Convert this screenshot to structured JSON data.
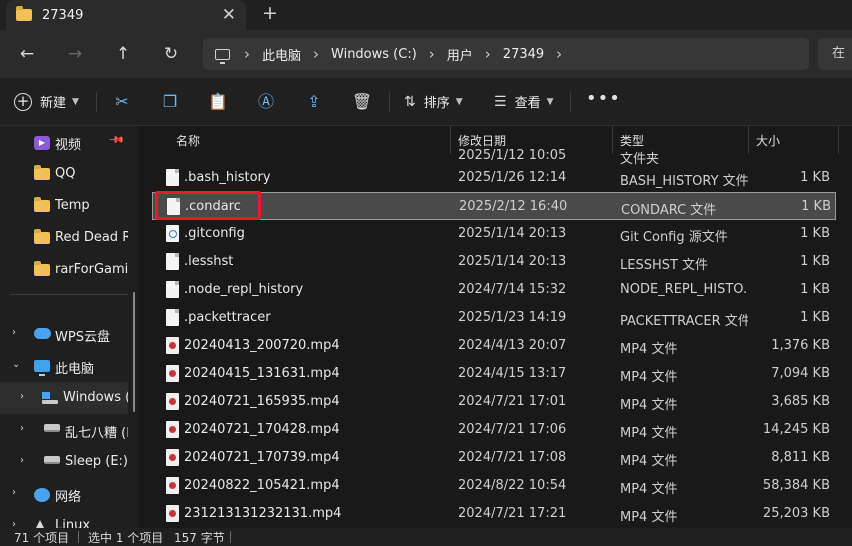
{
  "tab": {
    "title": "27349"
  },
  "address": {
    "crumbs": [
      "此电脑",
      "Windows (C:)",
      "用户",
      "27349"
    ],
    "search_hint": "在"
  },
  "toolbar": {
    "new_label": "新建",
    "sort_label": "排序",
    "view_label": "查看"
  },
  "sidebar": {
    "items": [
      {
        "label": "视频",
        "icon": "video-icon"
      },
      {
        "label": "QQ",
        "icon": "folder-icon"
      },
      {
        "label": "Temp",
        "icon": "folder-icon"
      },
      {
        "label": "Red Dead R",
        "icon": "folder-icon"
      },
      {
        "label": "rarForGamin",
        "icon": "folder-icon"
      },
      {
        "label": "WPS云盘",
        "icon": "cloud-icon"
      },
      {
        "label": "此电脑",
        "icon": "computer-icon"
      },
      {
        "label": "Windows (",
        "icon": "windows-drive-icon"
      },
      {
        "label": "乱七八糟 (D",
        "icon": "drive-icon"
      },
      {
        "label": "Sleep (E:)",
        "icon": "drive-icon"
      },
      {
        "label": "网络",
        "icon": "network-icon"
      },
      {
        "label": "Linux",
        "icon": "linux-icon"
      }
    ]
  },
  "columns": {
    "name": "名称",
    "date": "修改日期",
    "type": "类型",
    "size": "大小"
  },
  "partial_row": {
    "name": "",
    "date": "2025/1/12 10:05",
    "type": "文件夹"
  },
  "files": [
    {
      "name": ".bash_history",
      "date": "2025/1/26 12:14",
      "type": "BASH_HISTORY 文件",
      "size": "1 KB",
      "icon": "doc"
    },
    {
      "name": ".condarc",
      "date": "2025/2/12 16:40",
      "type": "CONDARC 文件",
      "size": "1 KB",
      "icon": "doc"
    },
    {
      "name": ".gitconfig",
      "date": "2025/1/14 20:13",
      "type": "Git Config 源文件",
      "size": "1 KB",
      "icon": "git"
    },
    {
      "name": ".lesshst",
      "date": "2025/1/14 20:13",
      "type": "LESSHST 文件",
      "size": "1 KB",
      "icon": "doc"
    },
    {
      "name": ".node_repl_history",
      "date": "2024/7/14 15:32",
      "type": "NODE_REPL_HISTO...",
      "size": "1 KB",
      "icon": "doc"
    },
    {
      "name": ".packettracer",
      "date": "2025/1/23 14:19",
      "type": "PACKETTRACER 文件",
      "size": "1 KB",
      "icon": "doc"
    },
    {
      "name": "20240413_200720.mp4",
      "date": "2024/4/13 20:07",
      "type": "MP4 文件",
      "size": "1,376 KB",
      "icon": "mp4"
    },
    {
      "name": "20240415_131631.mp4",
      "date": "2024/4/15 13:17",
      "type": "MP4 文件",
      "size": "7,094 KB",
      "icon": "mp4"
    },
    {
      "name": "20240721_165935.mp4",
      "date": "2024/7/21 17:01",
      "type": "MP4 文件",
      "size": "3,685 KB",
      "icon": "mp4"
    },
    {
      "name": "20240721_170428.mp4",
      "date": "2024/7/21 17:06",
      "type": "MP4 文件",
      "size": "14,245 KB",
      "icon": "mp4"
    },
    {
      "name": "20240721_170739.mp4",
      "date": "2024/7/21 17:08",
      "type": "MP4 文件",
      "size": "8,811 KB",
      "icon": "mp4"
    },
    {
      "name": "20240822_105421.mp4",
      "date": "2024/8/22 10:54",
      "type": "MP4 文件",
      "size": "58,384 KB",
      "icon": "mp4"
    },
    {
      "name": "231213131232131.mp4",
      "date": "2024/7/21 17:21",
      "type": "MP4 文件",
      "size": "25,203 KB",
      "icon": "mp4"
    }
  ],
  "selected_index": 1,
  "status": {
    "item_count": "71 个项目",
    "selection": "选中 1 个项目",
    "selection_size": "157 字节"
  }
}
